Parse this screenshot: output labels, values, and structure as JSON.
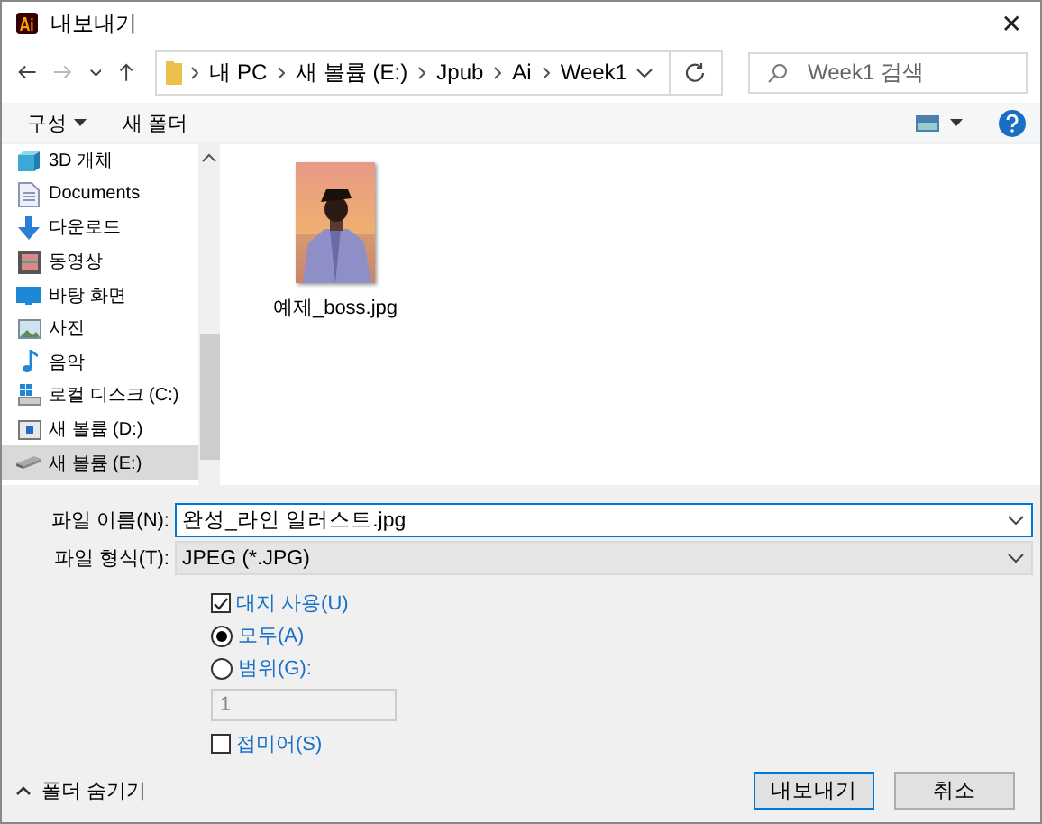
{
  "window": {
    "title": "내보내기",
    "close": "✕"
  },
  "address": {
    "crumbs": [
      "내 PC",
      "새 볼륨 (E:)",
      "Jpub",
      "Ai",
      "Week1"
    ]
  },
  "search": {
    "placeholder": "Week1 검색"
  },
  "toolbar": {
    "organize": "구성",
    "new_folder": "새 폴더"
  },
  "sidebar": {
    "items": [
      {
        "label": "3D 개체",
        "selected": false
      },
      {
        "label": "Documents",
        "selected": false
      },
      {
        "label": "다운로드",
        "selected": false
      },
      {
        "label": "동영상",
        "selected": false
      },
      {
        "label": "바탕 화면",
        "selected": false
      },
      {
        "label": "사진",
        "selected": false
      },
      {
        "label": "음악",
        "selected": false
      },
      {
        "label": "로컬 디스크 (C:)",
        "selected": false
      },
      {
        "label": "새 볼륨 (D:)",
        "selected": false
      },
      {
        "label": "새 볼륨 (E:)",
        "selected": true
      }
    ]
  },
  "files": [
    {
      "name": "예제_boss.jpg",
      "kind": "picture"
    }
  ],
  "form": {
    "file_name": {
      "label": "파일 이름(N):",
      "value": "완성_라인 일러스트.jpg"
    },
    "file_type": {
      "label": "파일 형식(T):",
      "value": "JPEG (*.JPG)"
    },
    "options": [
      {
        "kind": "checkbox",
        "label": "대지 사용(U)",
        "checked": true
      },
      {
        "kind": "radio",
        "label": "모두(A)",
        "selected": true
      },
      {
        "kind": "radio",
        "label": "범위(G):",
        "selected": false
      },
      {
        "kind": "input",
        "value": "1",
        "disabled": true
      },
      {
        "kind": "checkbox",
        "label": "접미어(S)",
        "checked": false
      }
    ]
  },
  "footer": {
    "hide_folders": "폴더 숨기기",
    "buttons": [
      "내보내기",
      "취소"
    ]
  }
}
